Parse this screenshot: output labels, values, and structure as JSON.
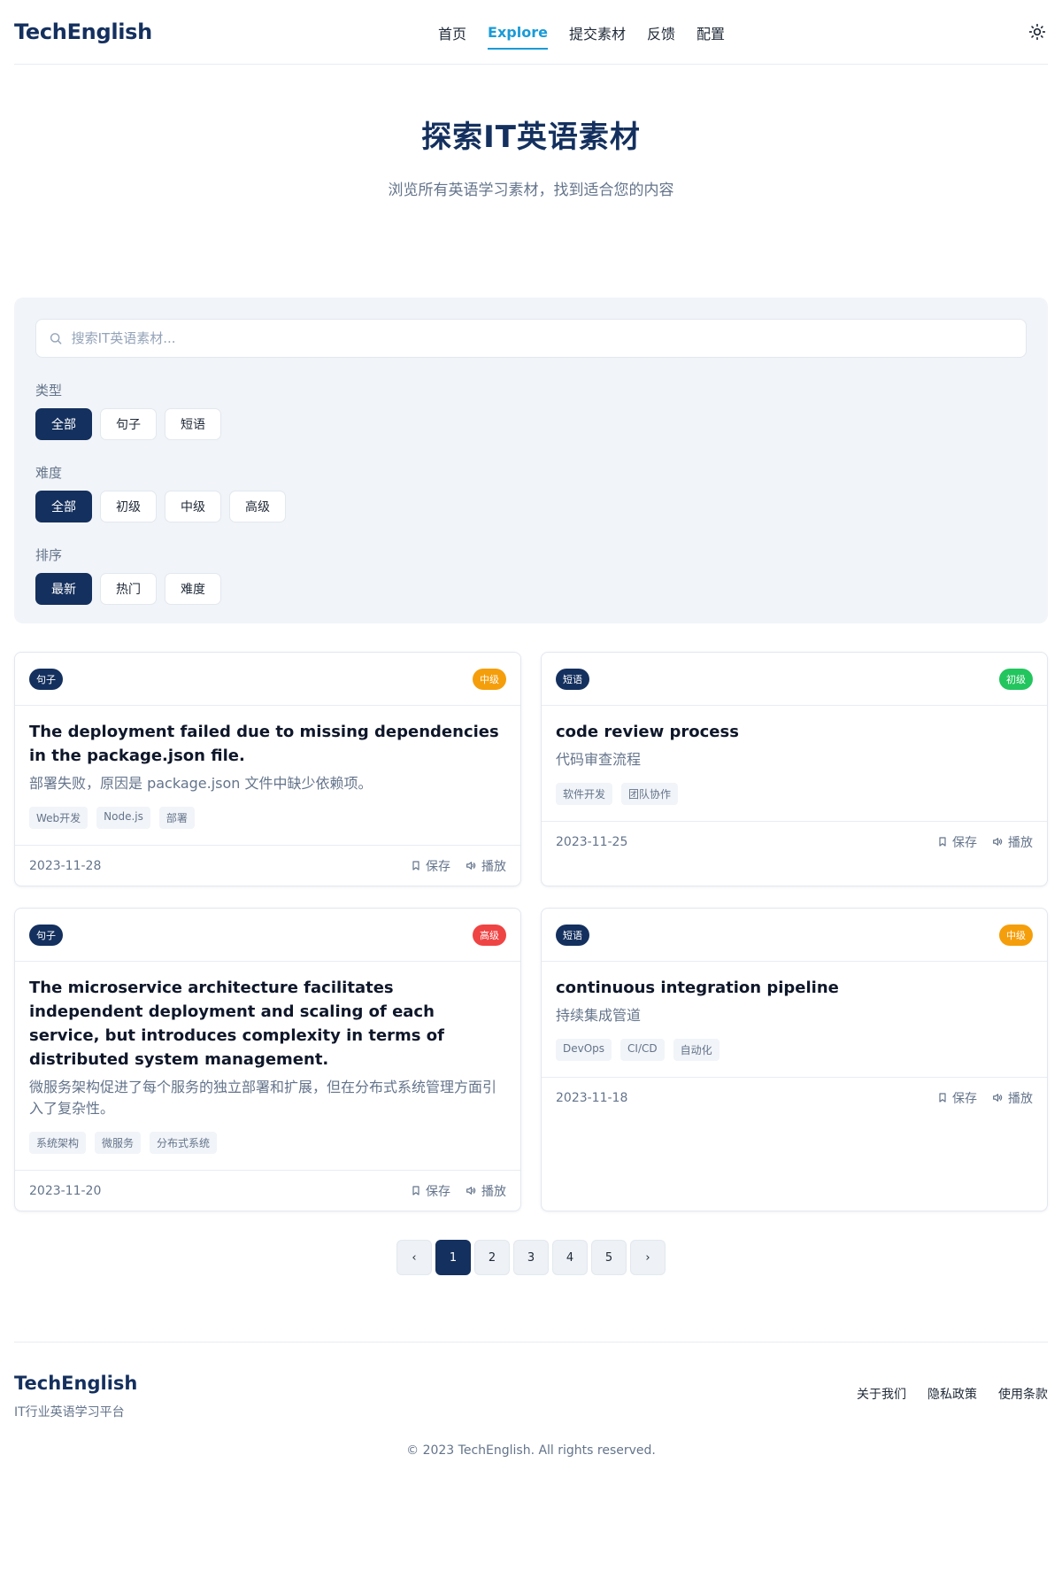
{
  "header": {
    "brand": "TechEnglish",
    "nav": [
      "首页",
      "Explore",
      "提交素材",
      "反馈",
      "配置"
    ],
    "active_nav": "Explore",
    "theme_icon": "sun-icon"
  },
  "hero": {
    "title": "探索IT英语素材",
    "subtitle": "浏览所有英语学习素材，找到适合您的内容"
  },
  "filters": {
    "search_placeholder": "搜索IT英语素材...",
    "type": {
      "label": "类型",
      "options": [
        "全部",
        "句子",
        "短语"
      ],
      "selected": "全部"
    },
    "difficulty": {
      "label": "难度",
      "options": [
        "全部",
        "初级",
        "中级",
        "高级"
      ],
      "selected": "全部"
    },
    "sort": {
      "label": "排序",
      "options": [
        "最新",
        "热门",
        "难度"
      ],
      "selected": "最新"
    }
  },
  "colors": {
    "primary": "#14305e",
    "accent": "#1a9bd7",
    "level_beginner": "#22c55e",
    "level_intermediate": "#f59e0b",
    "level_advanced": "#ef4444"
  },
  "cards": [
    {
      "type": "句子",
      "level": "中级",
      "level_color": "#f59e0b",
      "title": "The deployment failed due to missing dependencies in the package.json file.",
      "translation": "部署失败，原因是 package.json 文件中缺少依赖项。",
      "tags": [
        "Web开发",
        "Node.js",
        "部署"
      ],
      "date": "2023-11-28",
      "save_label": "保存",
      "play_label": "播放"
    },
    {
      "type": "短语",
      "level": "初级",
      "level_color": "#22c55e",
      "title": "code review process",
      "translation": "代码审查流程",
      "tags": [
        "软件开发",
        "团队协作"
      ],
      "date": "2023-11-25",
      "save_label": "保存",
      "play_label": "播放"
    },
    {
      "type": "句子",
      "level": "高级",
      "level_color": "#ef4444",
      "title": "The microservice architecture facilitates independent deployment and scaling of each service, but introduces complexity in terms of distributed system management.",
      "translation": "微服务架构促进了每个服务的独立部署和扩展，但在分布式系统管理方面引入了复杂性。",
      "tags": [
        "系统架构",
        "微服务",
        "分布式系统"
      ],
      "date": "2023-11-20",
      "save_label": "保存",
      "play_label": "播放"
    },
    {
      "type": "短语",
      "level": "中级",
      "level_color": "#f59e0b",
      "title": "continuous integration pipeline",
      "translation": "持续集成管道",
      "tags": [
        "DevOps",
        "CI/CD",
        "自动化"
      ],
      "date": "2023-11-18",
      "save_label": "保存",
      "play_label": "播放"
    }
  ],
  "pagination": {
    "prev": "‹",
    "pages": [
      "1",
      "2",
      "3",
      "4",
      "5"
    ],
    "current": "1",
    "next": "›"
  },
  "footer": {
    "brand": "TechEnglish",
    "tagline": "IT行业英语学习平台",
    "links": [
      "关于我们",
      "隐私政策",
      "使用条款"
    ],
    "copyright": "© 2023 TechEnglish. All rights reserved."
  }
}
